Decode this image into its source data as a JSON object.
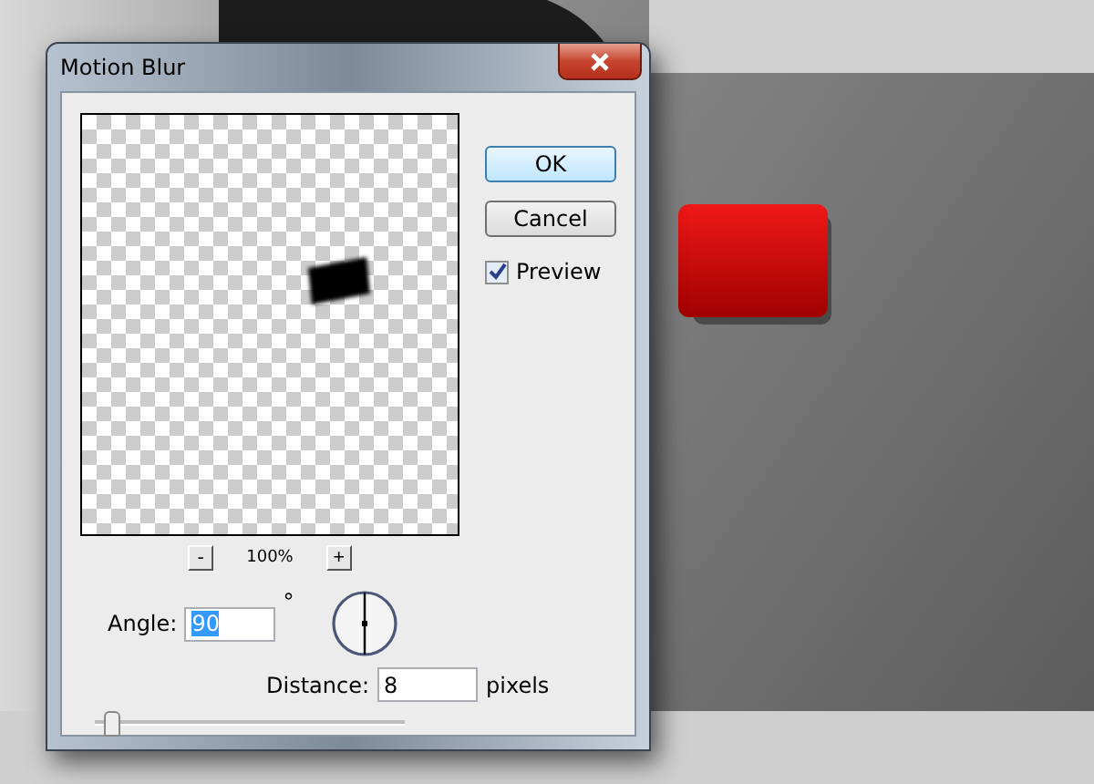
{
  "window": {
    "title": "Motion Blur"
  },
  "preview": {
    "zoom": "100%",
    "zoom_out": "-",
    "zoom_in": "+"
  },
  "buttons": [
    {
      "label": "OK",
      "default": true
    },
    {
      "label": "Cancel",
      "default": false
    }
  ],
  "preview_checkbox": {
    "label": "Preview",
    "checked": true
  },
  "angle": {
    "label": "Angle:",
    "value": "90",
    "unit": "°",
    "selected": true
  },
  "distance": {
    "label": "Distance:",
    "value": "8",
    "unit": "pixels",
    "level": 0.05
  }
}
